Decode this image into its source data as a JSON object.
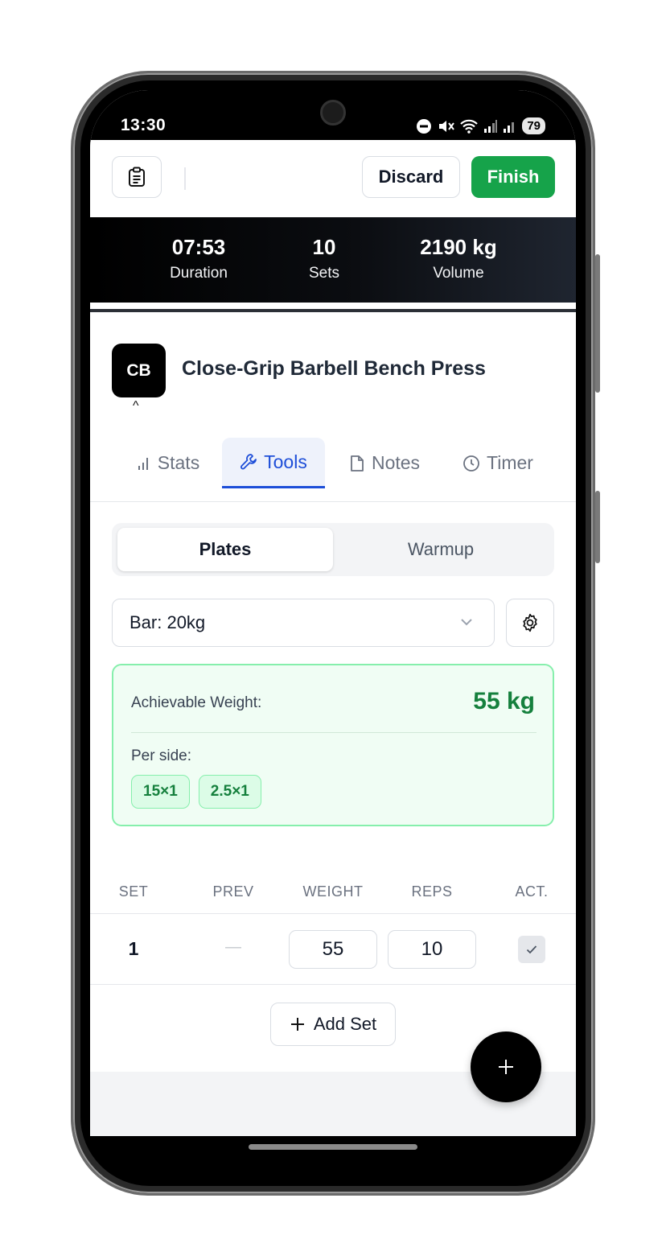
{
  "status_bar": {
    "time": "13:30",
    "battery": "79"
  },
  "header": {
    "discard_label": "Discard",
    "finish_label": "Finish",
    "accent": "#16a34a"
  },
  "summary": {
    "duration_value": "07:53",
    "duration_label": "Duration",
    "sets_value": "10",
    "sets_label": "Sets",
    "volume_value": "2190 kg",
    "volume_label": "Volume"
  },
  "exercise": {
    "avatar": "CB",
    "title": "Close-Grip Barbell Bench Press"
  },
  "tabs": [
    {
      "label": "Stats",
      "icon": "bar-chart-icon"
    },
    {
      "label": "Tools",
      "icon": "wrench-icon",
      "active": true
    },
    {
      "label": "Notes",
      "icon": "file-icon"
    },
    {
      "label": "Timer",
      "icon": "clock-icon"
    }
  ],
  "tools": {
    "segments": [
      "Plates",
      "Warmup"
    ],
    "active_segment": "Plates",
    "bar_select": "Bar: 20kg",
    "result": {
      "label": "Achievable Weight:",
      "value": "55 kg",
      "per_side_label": "Per side:",
      "plates": [
        "15×1",
        "2.5×1"
      ]
    }
  },
  "table": {
    "headers": [
      "SET",
      "PREV",
      "WEIGHT",
      "REPS",
      "ACT."
    ],
    "rows": [
      {
        "set": "1",
        "prev": "—",
        "weight": "55",
        "reps": "10"
      }
    ],
    "add_set_label": "Add Set"
  }
}
